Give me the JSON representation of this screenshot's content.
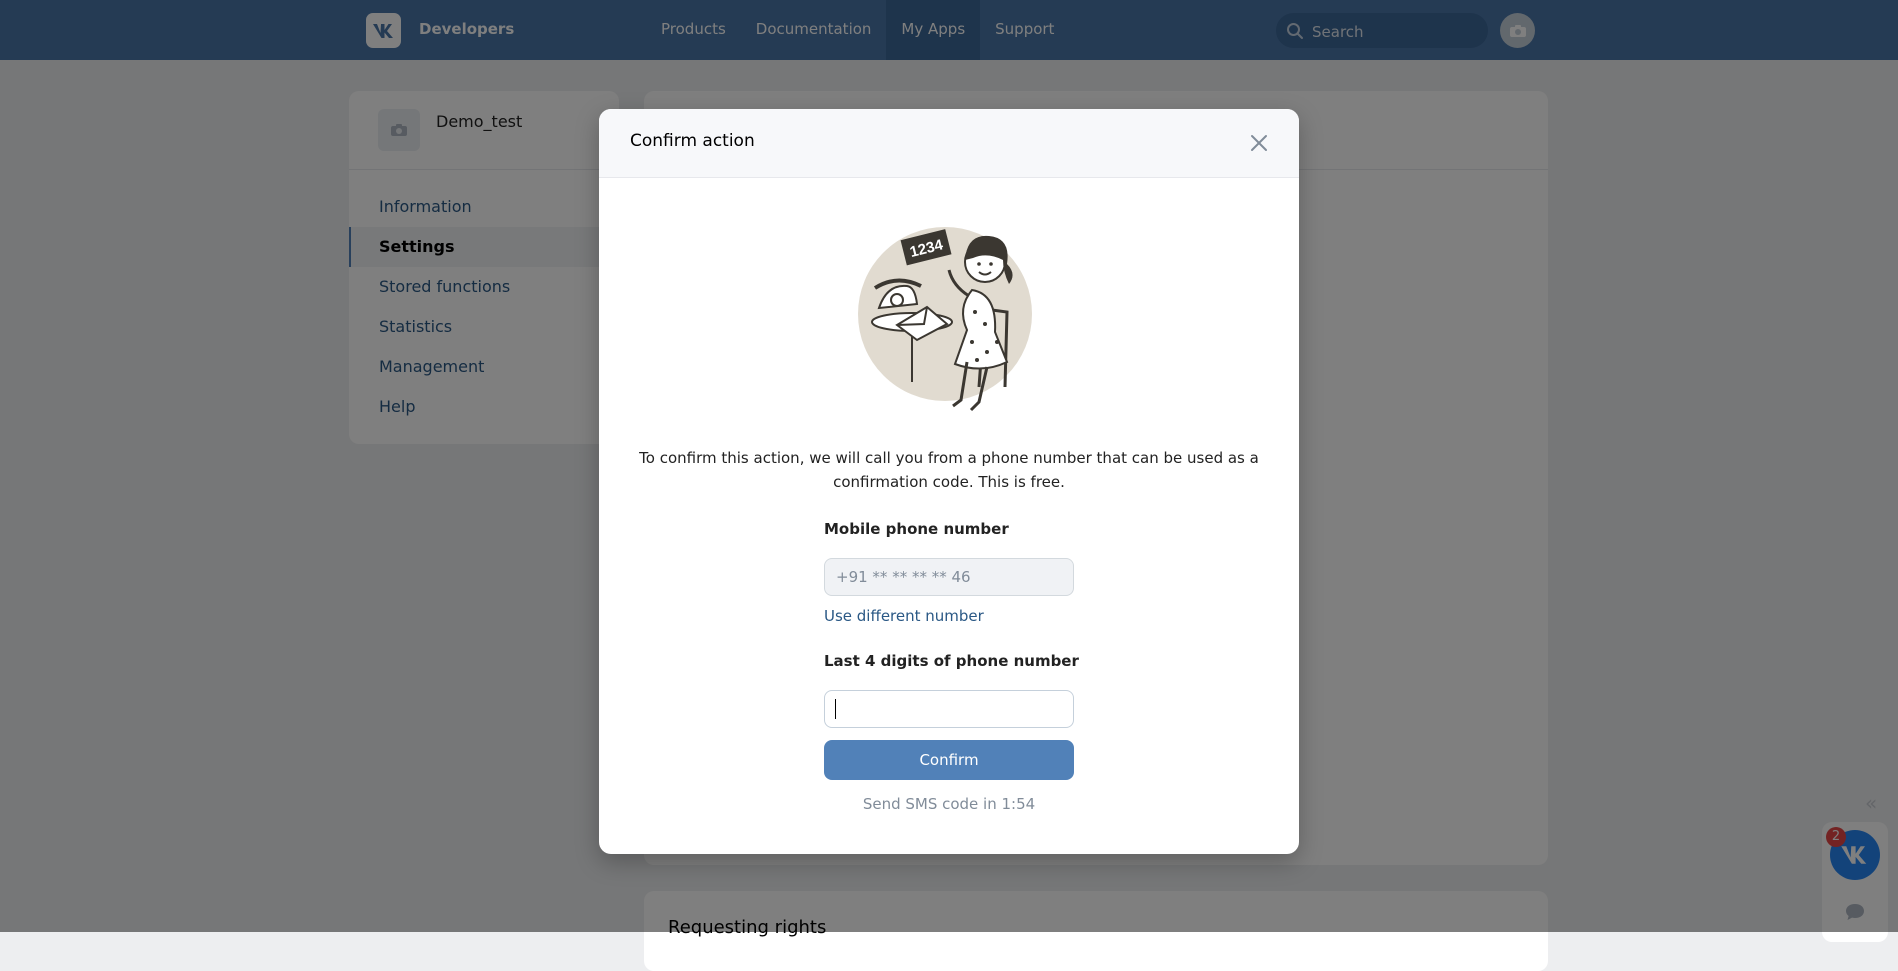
{
  "header": {
    "brand": "Developers",
    "nav": [
      {
        "label": "Products",
        "active": false
      },
      {
        "label": "Documentation",
        "active": false
      },
      {
        "label": "My Apps",
        "active": true
      },
      {
        "label": "Support",
        "active": false
      }
    ],
    "search_placeholder": "Search"
  },
  "sidebar": {
    "app_name": "Demo_test",
    "items": [
      {
        "label": "Information"
      },
      {
        "label": "Settings"
      },
      {
        "label": "Stored functions"
      },
      {
        "label": "Statistics"
      },
      {
        "label": "Management"
      },
      {
        "label": "Help"
      }
    ]
  },
  "main": {
    "section_title": "Requesting rights"
  },
  "modal": {
    "title": "Confirm action",
    "illustration_badge": "1234",
    "description": "To confirm this action, we will call you from a phone number that can be used as a confirmation code. This is free.",
    "phone_label": "Mobile phone number",
    "phone_placeholder": "+91 ** ** ** ** 46",
    "different_number_link": "Use different number",
    "digits_label": "Last 4 digits of phone number",
    "digits_value": "",
    "confirm_button": "Confirm",
    "sms_text": "Send SMS code in 1:54"
  },
  "widget": {
    "badge_count": "2",
    "collapse_icon": "«"
  },
  "colors": {
    "brand_blue": "#4a76a8",
    "button_blue": "#5181b8",
    "link": "#2a5885",
    "badge_red": "#e64646"
  }
}
